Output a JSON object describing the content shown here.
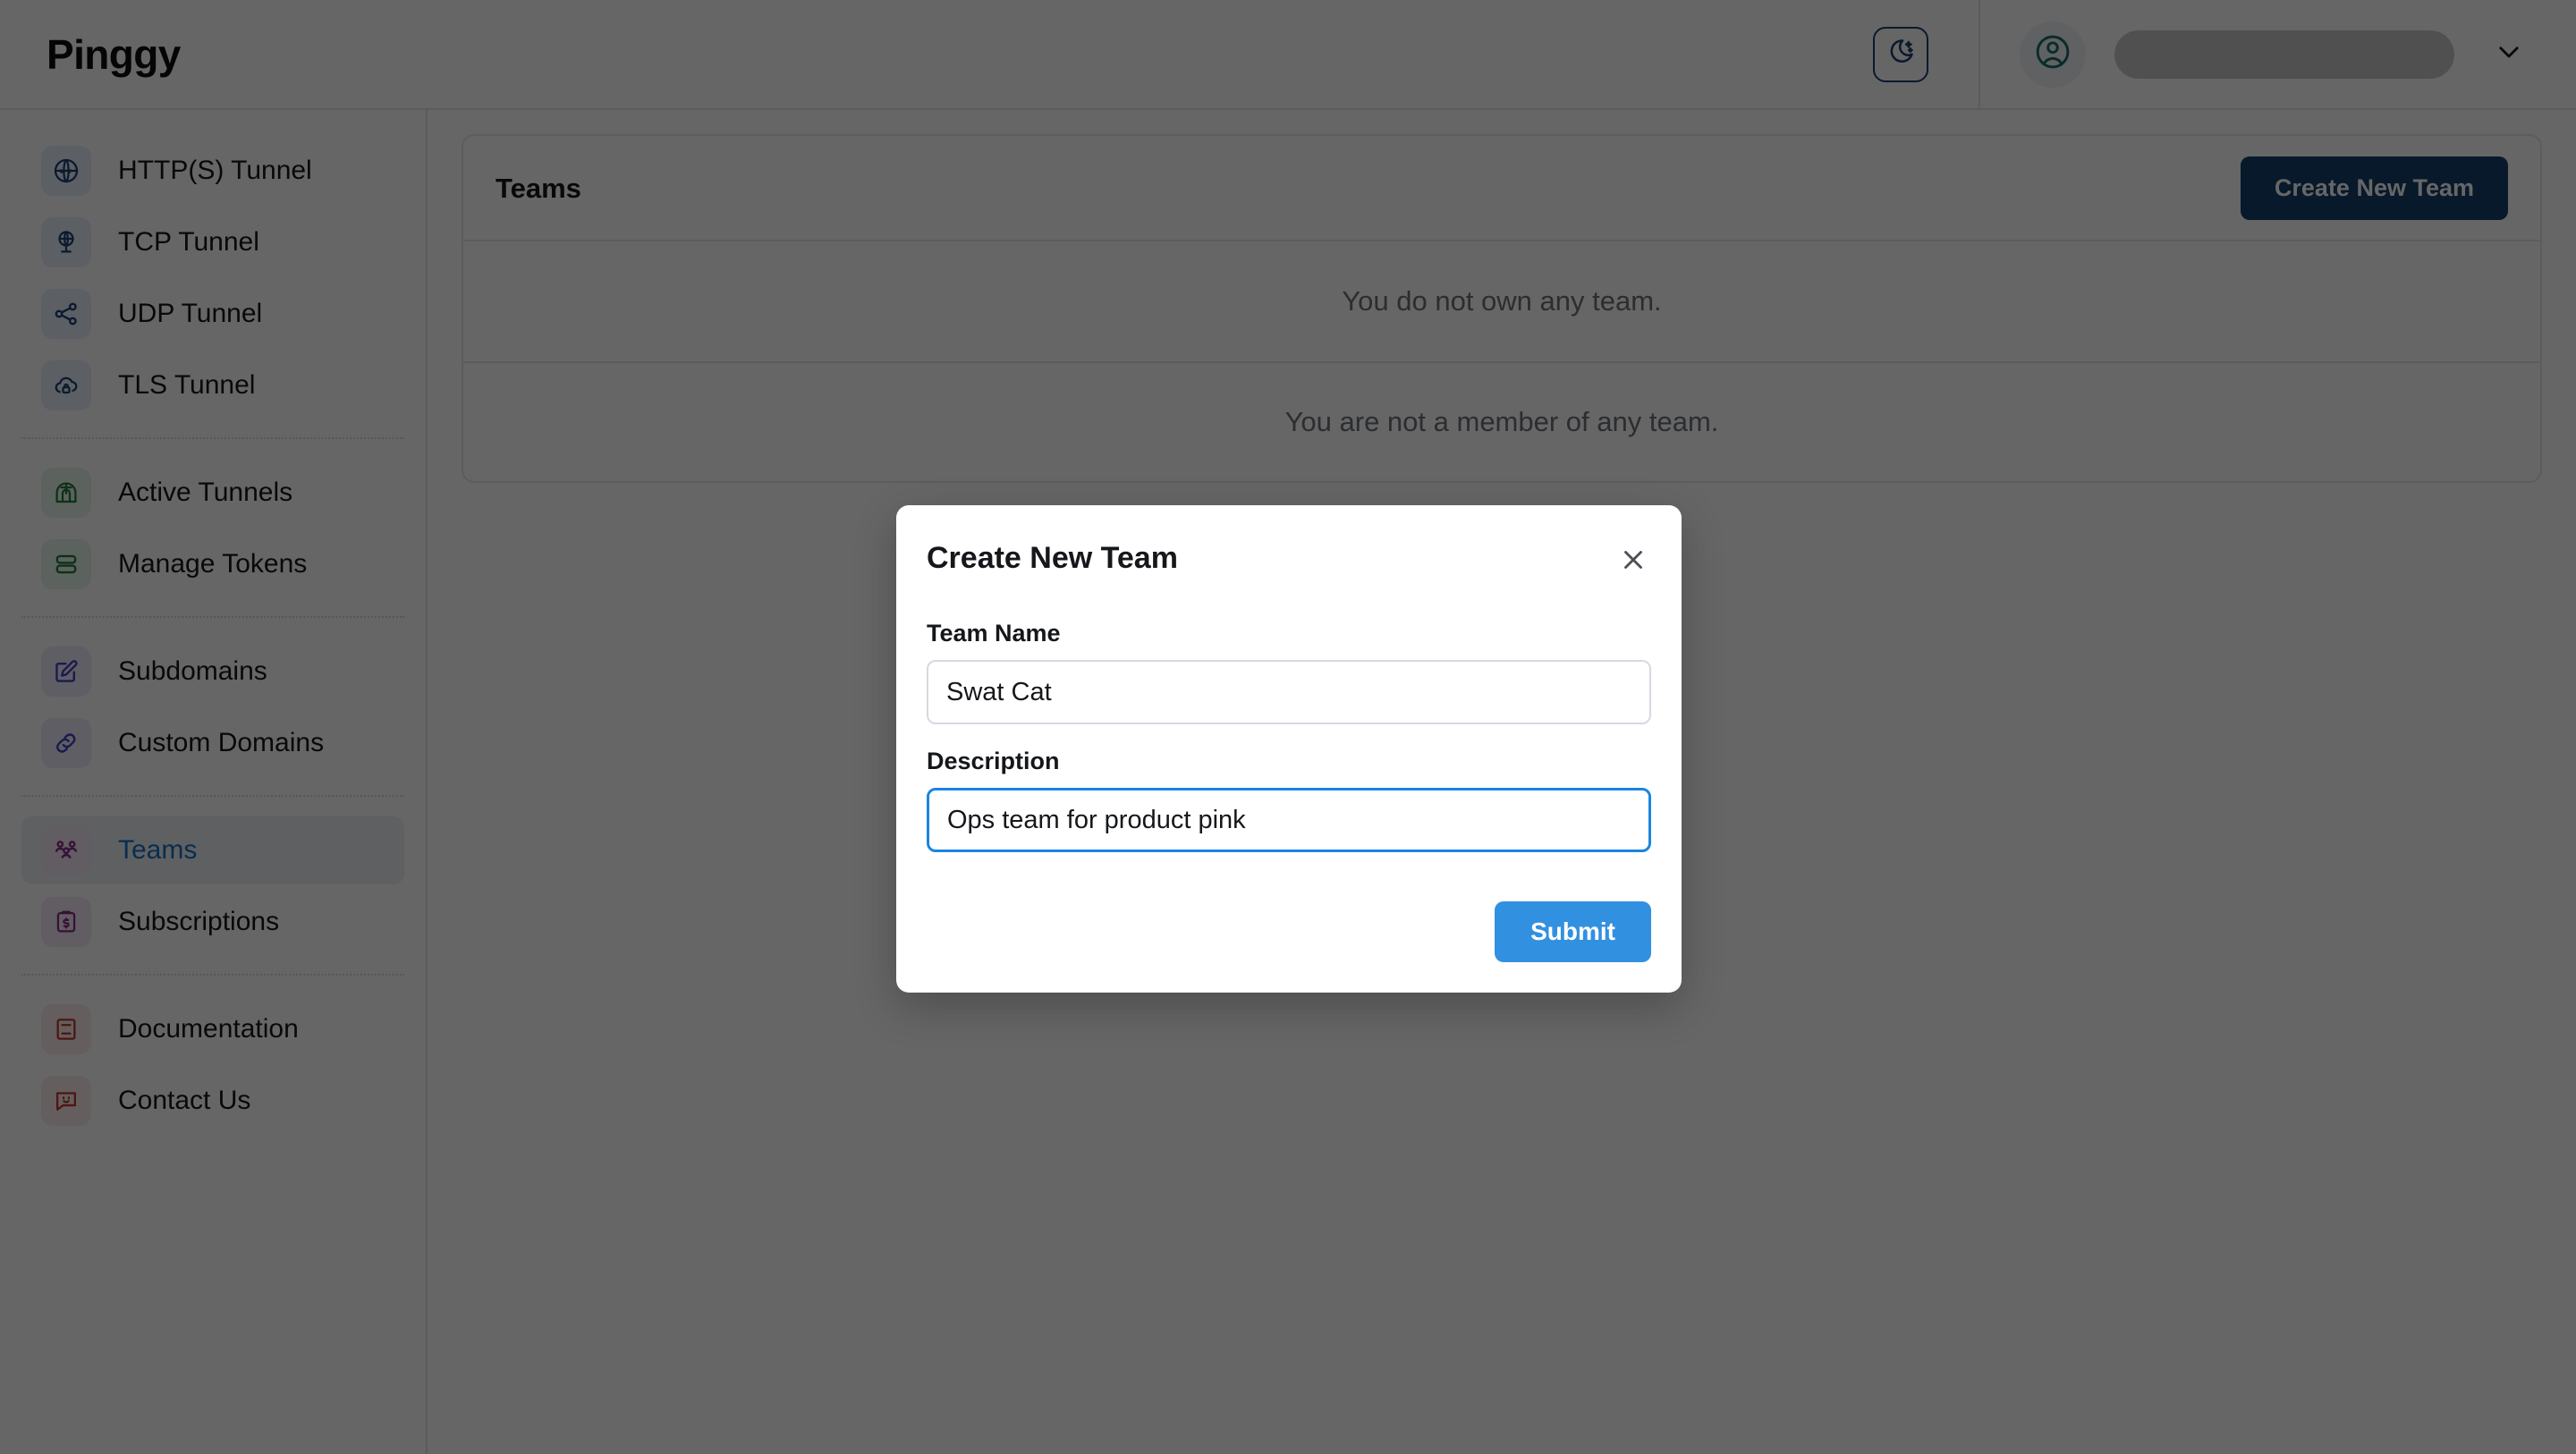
{
  "header": {
    "brand": "Pinggy",
    "theme_toggle_icon": "moon-stars-icon",
    "avatar_icon": "user-circle-icon",
    "username_value": "",
    "account_chevron_icon": "chevron-down-icon"
  },
  "sidebar": {
    "groups": [
      {
        "items": [
          {
            "label": "HTTP(S) Tunnel",
            "icon": "globe-www-icon",
            "tint": "t-blue",
            "active": false
          },
          {
            "label": "TCP Tunnel",
            "icon": "globe-pin-icon",
            "tint": "t-blue",
            "active": false
          },
          {
            "label": "UDP Tunnel",
            "icon": "share-nodes-icon",
            "tint": "t-blue",
            "active": false
          },
          {
            "label": "TLS Tunnel",
            "icon": "cloud-lock-icon",
            "tint": "t-blue",
            "active": false
          }
        ]
      },
      {
        "items": [
          {
            "label": "Active Tunnels",
            "icon": "tunnel-icon",
            "tint": "t-green",
            "active": false
          },
          {
            "label": "Manage Tokens",
            "icon": "tokens-icon",
            "tint": "t-green",
            "active": false
          }
        ]
      },
      {
        "items": [
          {
            "label": "Subdomains",
            "icon": "pencil-square-icon",
            "tint": "t-indigo",
            "active": false
          },
          {
            "label": "Custom Domains",
            "icon": "link-icon",
            "tint": "t-indigo",
            "active": false
          }
        ]
      },
      {
        "items": [
          {
            "label": "Teams",
            "icon": "users-group-icon",
            "tint": "t-purple",
            "active": true
          },
          {
            "label": "Subscriptions",
            "icon": "clipboard-dollar-icon",
            "tint": "t-purple",
            "active": false
          }
        ]
      },
      {
        "items": [
          {
            "label": "Documentation",
            "icon": "book-icon",
            "tint": "t-red",
            "active": false
          },
          {
            "label": "Contact Us",
            "icon": "chat-smile-icon",
            "tint": "t-red",
            "active": false
          }
        ]
      }
    ]
  },
  "main": {
    "panel_title": "Teams",
    "create_team_label": "Create New Team",
    "empty_owned": "You do not own any team.",
    "empty_member": "You are not a member of any team."
  },
  "modal": {
    "title": "Create New Team",
    "close_icon": "close-x-icon",
    "team_name_label": "Team Name",
    "team_name_value": "Swat Cat",
    "team_name_placeholder": "",
    "description_label": "Description",
    "description_value": "Ops team for product pink",
    "description_placeholder": "",
    "submit_label": "Submit"
  },
  "colors": {
    "brand_dark_blue": "#123f6d",
    "submit_blue": "#3290e0",
    "focus_blue": "#1a85e0",
    "active_nav_text": "#1673c4",
    "overlay": "rgba(0,0,0,0.60)"
  }
}
